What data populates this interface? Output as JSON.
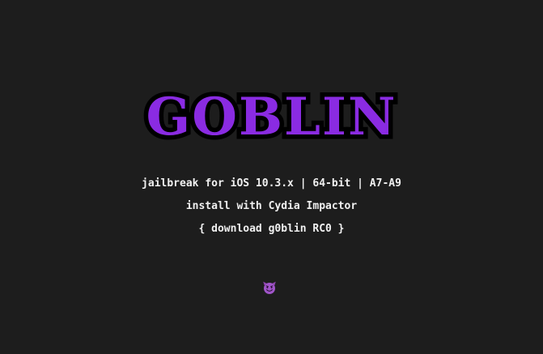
{
  "logo": {
    "text": "GOBLIN",
    "color": "#8a2be2"
  },
  "info": {
    "description": "jailbreak for iOS 10.3.x | 64-bit | A7-A9",
    "install": "install with Cydia Impactor"
  },
  "download": {
    "open_brace": "{ ",
    "label": "download g0blin RC0",
    "close_brace": " }"
  },
  "footer": {
    "emoji_icon": "smiling-imp-icon"
  },
  "colors": {
    "background": "#1d1d1d",
    "text": "#f0f0f0",
    "accent": "#8a2be2"
  }
}
